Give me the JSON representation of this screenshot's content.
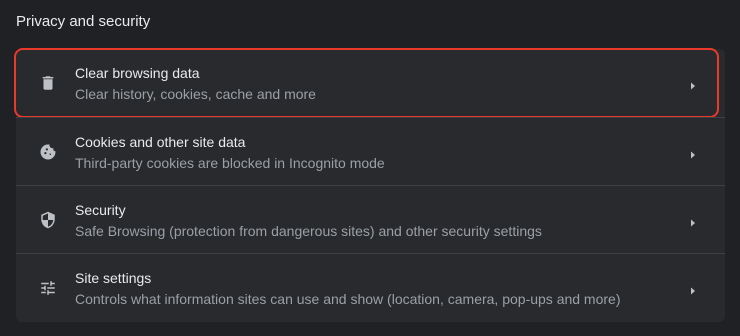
{
  "section": {
    "title": "Privacy and security"
  },
  "rows": [
    {
      "label": "Clear browsing data",
      "sublabel": "Clear history, cookies, cache and more",
      "icon": "trash-icon"
    },
    {
      "label": "Cookies and other site data",
      "sublabel": "Third-party cookies are blocked in Incognito mode",
      "icon": "cookie-icon"
    },
    {
      "label": "Security",
      "sublabel": "Safe Browsing (protection from dangerous sites) and other security settings",
      "icon": "shield-icon"
    },
    {
      "label": "Site settings",
      "sublabel": "Controls what information sites can use and show (location, camera, pop-ups and more)",
      "icon": "sliders-icon"
    }
  ],
  "colors": {
    "background": "#202124",
    "card": "#292a2d",
    "highlight": "#e8392b"
  }
}
